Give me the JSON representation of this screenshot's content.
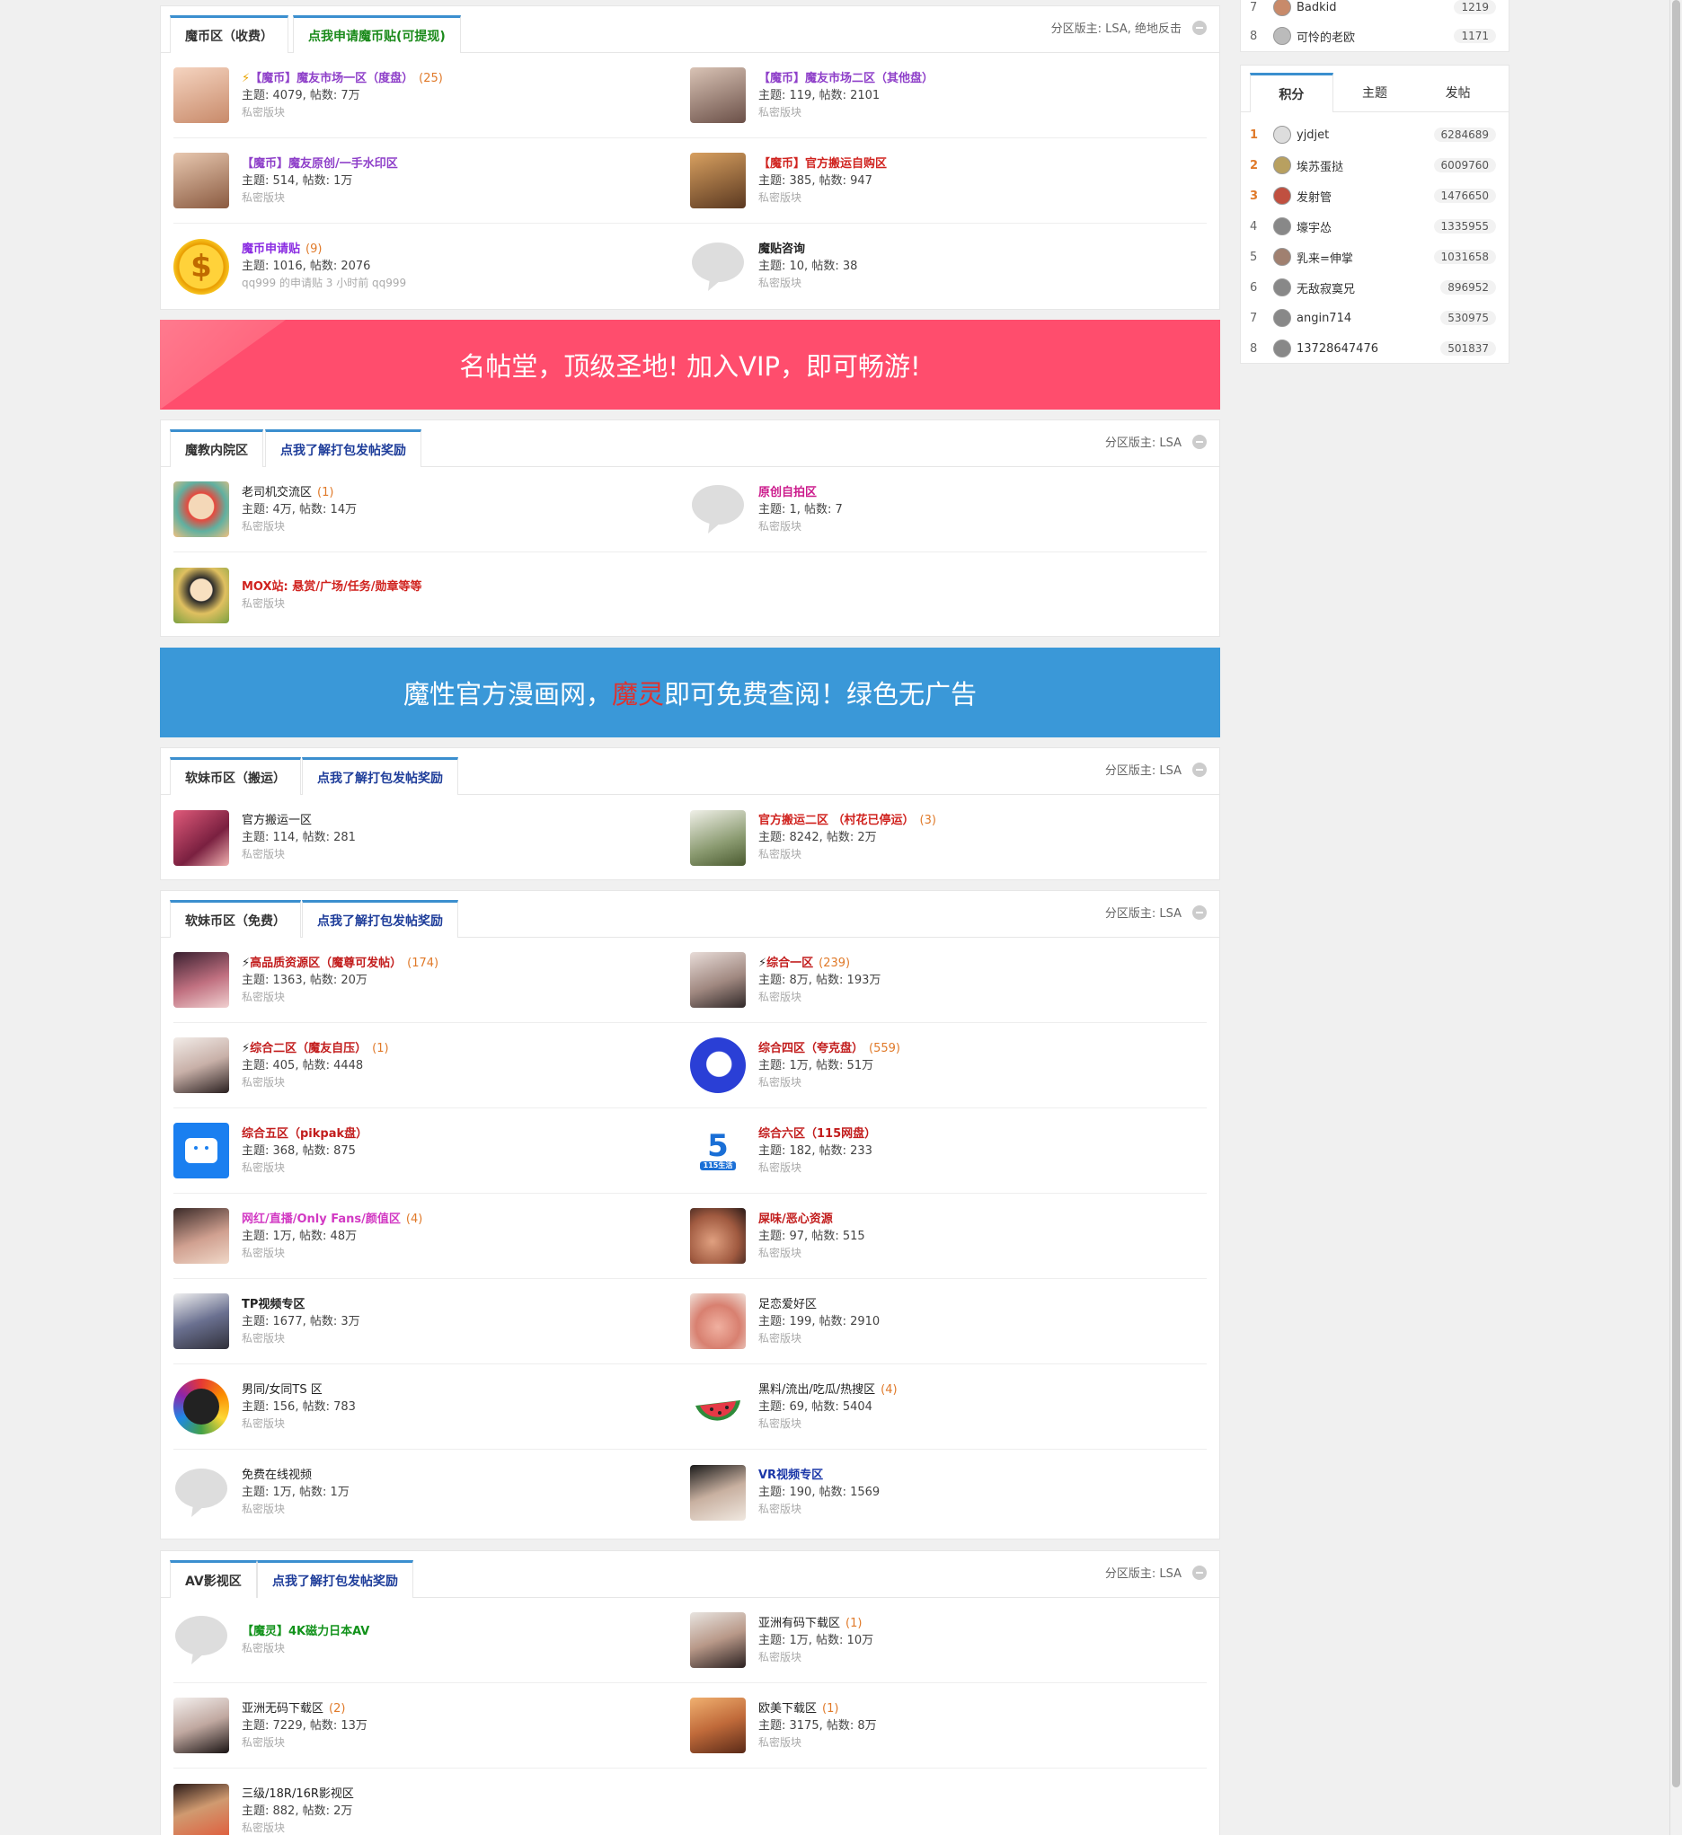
{
  "sections": [
    {
      "tabs": [
        "魔币区（收费）",
        "点我申请魔币贴(可提现)"
      ],
      "moderators": "分区版主: LSA, 绝地反击",
      "forums": [
        {
          "name": "【魔币】魔友市场一区（度盘）",
          "count": "(25)",
          "stats": "主题: 4079, 帖数: 7万",
          "sub": "私密版块"
        },
        {
          "name": "【魔币】魔友市场二区（其他盘）",
          "count": "",
          "stats": "主题: 119, 帖数: 2101",
          "sub": "私密版块"
        },
        {
          "name": "【魔币】魔友原创/一手水印区",
          "count": "",
          "stats": "主题: 514, 帖数: 1万",
          "sub": "私密版块"
        },
        {
          "name": "【魔币】官方搬运自购区",
          "count": "",
          "stats": "主题: 385, 帖数: 947",
          "sub": "私密版块"
        },
        {
          "name": "魔币申请贴",
          "count": "(9)",
          "stats": "主题: 1016, 帖数: 2076",
          "sub": "qq999 的申请贴 3 小时前 qq999"
        },
        {
          "name": "魔贴咨询",
          "count": "",
          "stats": "主题: 10, 帖数: 38",
          "sub": "私密版块"
        }
      ]
    },
    {
      "tabs": [
        "魔教内院区",
        "点我了解打包发帖奖励"
      ],
      "moderators": "分区版主: LSA",
      "forums": [
        {
          "name": "老司机交流区",
          "count": "(1)",
          "stats": "主题: 4万, 帖数: 14万",
          "sub": "私密版块"
        },
        {
          "name": "原创自拍区",
          "count": "",
          "stats": "主题: 1, 帖数: 7",
          "sub": "私密版块"
        },
        {
          "name": "MOX站: 悬赏/广场/任务/勋章等等",
          "count": "",
          "stats": "",
          "sub": "私密版块"
        }
      ]
    },
    {
      "tabs": [
        "软妹币区（搬运）",
        "点我了解打包发帖奖励"
      ],
      "moderators": "分区版主: LSA",
      "forums": [
        {
          "name": "官方搬运一区",
          "count": "",
          "stats": "主题: 114, 帖数: 281",
          "sub": "私密版块"
        },
        {
          "name": "官方搬运二区 （村花已停运）",
          "count": "(3)",
          "stats": "主题: 8242, 帖数: 2万",
          "sub": "私密版块"
        }
      ]
    },
    {
      "tabs": [
        "软妹币区（免费）",
        "点我了解打包发帖奖励"
      ],
      "moderators": "分区版主: LSA",
      "forums": [
        {
          "name": "高品质资源区（魔尊可发帖）",
          "count": "(174)",
          "stats": "主题: 1363, 帖数: 20万",
          "sub": "私密版块"
        },
        {
          "name": "综合一区",
          "count": "(239)",
          "stats": "主题: 8万, 帖数: 193万",
          "sub": "私密版块"
        },
        {
          "name": "综合二区（魔友自压）",
          "count": "(1)",
          "stats": "主题: 405, 帖数: 4448",
          "sub": "私密版块"
        },
        {
          "name": "综合四区（夸克盘）",
          "count": "(559)",
          "stats": "主题: 1万, 帖数: 51万",
          "sub": "私密版块"
        },
        {
          "name": "综合五区（pikpak盘）",
          "count": "",
          "stats": "主题: 368, 帖数: 875",
          "sub": "私密版块"
        },
        {
          "name": "综合六区（115网盘）",
          "count": "",
          "stats": "主题: 182, 帖数: 233",
          "sub": "私密版块"
        },
        {
          "name": "网红/直播/Only Fans/颜值区",
          "count": "(4)",
          "stats": "主题: 1万, 帖数: 48万",
          "sub": "私密版块"
        },
        {
          "name": "屎味/恶心资源",
          "count": "",
          "stats": "主题: 97, 帖数: 515",
          "sub": "私密版块"
        },
        {
          "name": "TP视频专区",
          "count": "",
          "stats": "主题: 1677, 帖数: 3万",
          "sub": "私密版块"
        },
        {
          "name": "足恋爱好区",
          "count": "",
          "stats": "主题: 199, 帖数: 2910",
          "sub": "私密版块"
        },
        {
          "name": "男同/女同TS 区",
          "count": "",
          "stats": "主题: 156, 帖数: 783",
          "sub": "私密版块"
        },
        {
          "name": "黑料/流出/吃瓜/热搜区",
          "count": "(4)",
          "stats": "主题: 69, 帖数: 5404",
          "sub": "私密版块"
        },
        {
          "name": "免费在线视频",
          "count": "",
          "stats": "主题: 1万, 帖数: 1万",
          "sub": "私密版块"
        },
        {
          "name": "VR视频专区",
          "count": "",
          "stats": "主题: 190, 帖数: 1569",
          "sub": "私密版块"
        }
      ]
    },
    {
      "tabs": [
        "AV影视区",
        "点我了解打包发帖奖励"
      ],
      "moderators": "分区版主: LSA",
      "forums": [
        {
          "name": "【魔灵】4K磁力日本AV",
          "count": "",
          "stats": "",
          "sub": "私密版块"
        },
        {
          "name": "亚洲有码下载区",
          "count": "(1)",
          "stats": "主题: 1万, 帖数: 10万",
          "sub": "私密版块"
        },
        {
          "name": "亚洲无码下载区",
          "count": "(2)",
          "stats": "主题: 7229, 帖数: 13万",
          "sub": "私密版块"
        },
        {
          "name": "欧美下载区",
          "count": "(1)",
          "stats": "主题: 3175, 帖数: 8万",
          "sub": "私密版块"
        },
        {
          "name": "三级/18R/16R影视区",
          "count": "",
          "stats": "主题: 882, 帖数: 2万",
          "sub": "私密版块"
        }
      ]
    }
  ],
  "banners": {
    "vip": "名帖堂，顶级圣地! 加入VIP，即可畅游!",
    "comic_pre": "魔性官方漫画网，",
    "comic_hl": "魔灵",
    "comic_post": "即可免费查阅！绿色无广告"
  },
  "sidebar_top": [
    {
      "rank": "7",
      "name": "Badkid",
      "score": "1219"
    },
    {
      "rank": "8",
      "name": "可怜的老欧",
      "score": "1171"
    }
  ],
  "leaderboard": {
    "tabs": [
      "积分",
      "主题",
      "发帖"
    ],
    "rows": [
      {
        "rank": "1",
        "name": "yjdjet",
        "score": "6284689"
      },
      {
        "rank": "2",
        "name": "埃苏蛋挞",
        "score": "6009760"
      },
      {
        "rank": "3",
        "name": "发射管",
        "score": "1476650"
      },
      {
        "rank": "4",
        "name": "壕宇怂",
        "score": "1335955"
      },
      {
        "rank": "5",
        "name": "乳来=伸掌",
        "score": "1031658"
      },
      {
        "rank": "6",
        "name": "无敌寂寞兄",
        "score": "896952"
      },
      {
        "rank": "7",
        "name": "angin714",
        "score": "530975"
      },
      {
        "rank": "8",
        "name": "13728647476",
        "score": "501837"
      }
    ]
  },
  "colors": {
    "tab_accent": "#3b8fcf",
    "vip_banner": "#ff4d6d",
    "comic_banner": "#3a98d8",
    "count": "#e07a2a"
  }
}
